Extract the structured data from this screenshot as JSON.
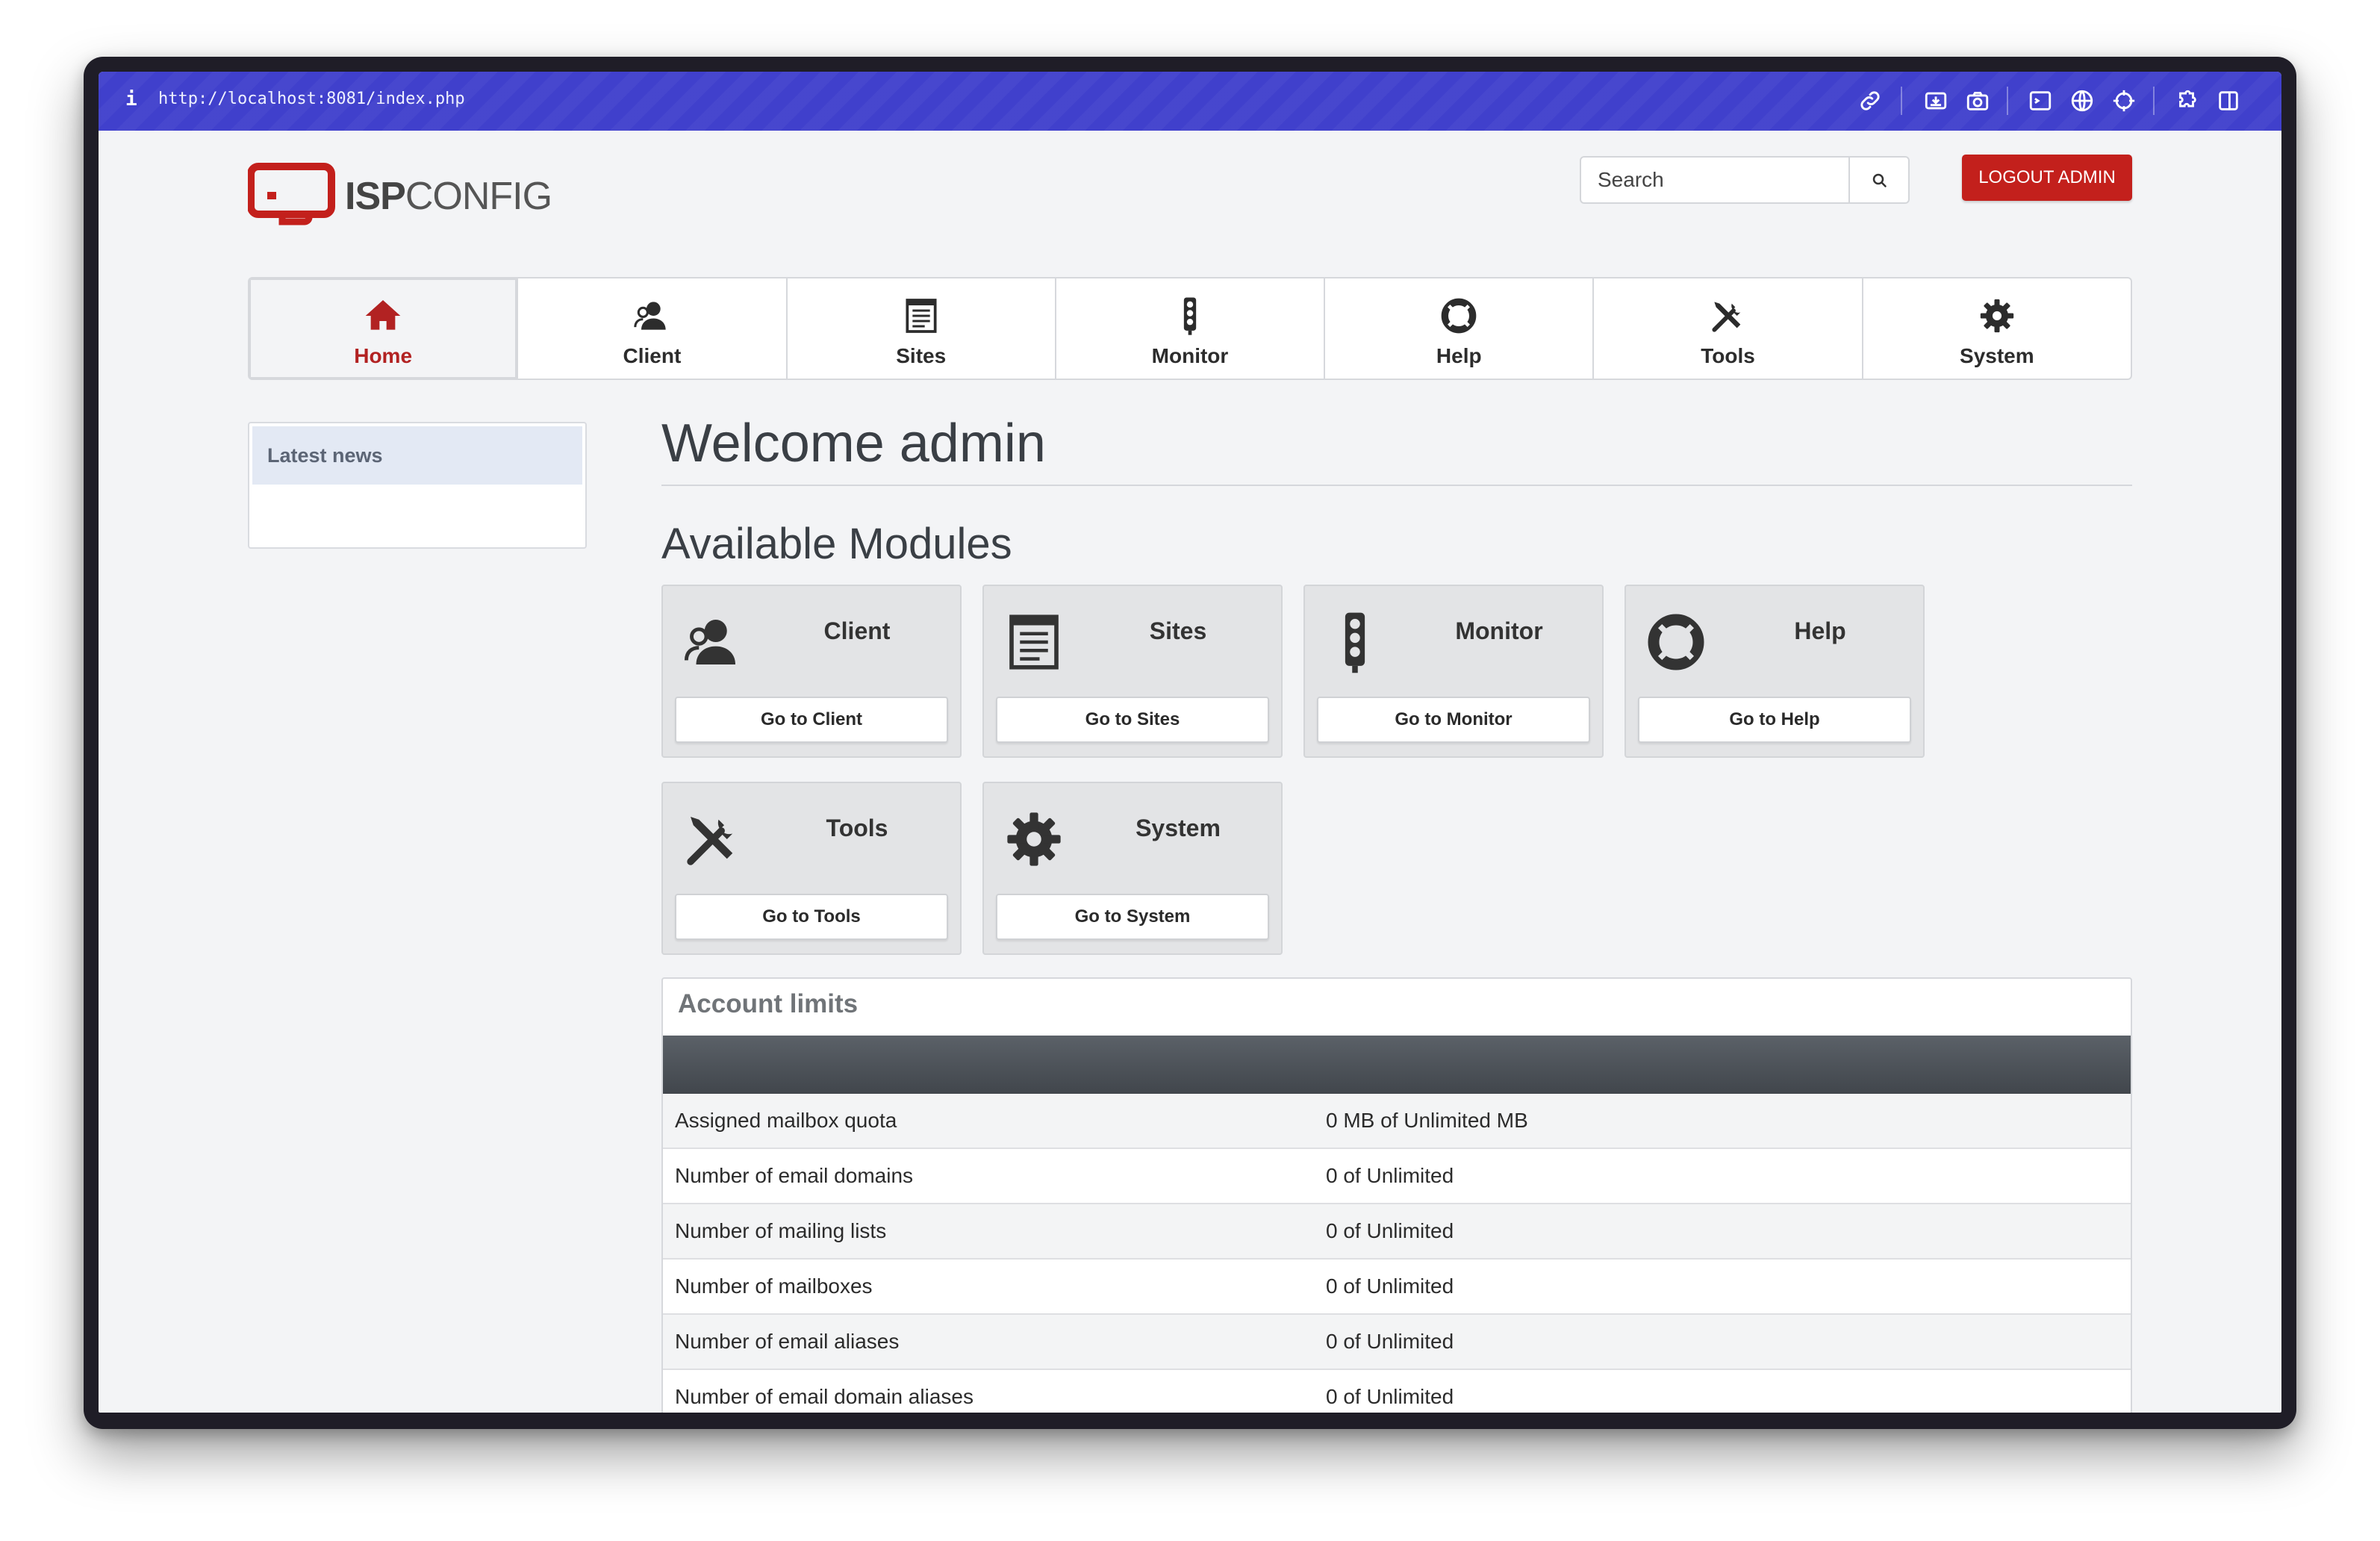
{
  "browser": {
    "info_glyph": "i",
    "url": "http://localhost:8081/index.php"
  },
  "brand": {
    "logo_bold": "ISP",
    "logo_light": "CONFIG",
    "accent_color": "#c3201c"
  },
  "header": {
    "search_placeholder": "Search",
    "logout_label": "LOGOUT ADMIN"
  },
  "nav": {
    "items": [
      {
        "label": "Home",
        "icon": "home-icon",
        "active": true
      },
      {
        "label": "Client",
        "icon": "client-icon"
      },
      {
        "label": "Sites",
        "icon": "sites-icon"
      },
      {
        "label": "Monitor",
        "icon": "monitor-icon"
      },
      {
        "label": "Help",
        "icon": "help-icon"
      },
      {
        "label": "Tools",
        "icon": "tools-icon"
      },
      {
        "label": "System",
        "icon": "system-icon"
      }
    ]
  },
  "sidebar": {
    "news_title": "Latest news"
  },
  "main": {
    "welcome": "Welcome admin",
    "modules_title": "Available Modules",
    "modules": [
      {
        "title": "Client",
        "button": "Go to Client",
        "icon": "client-icon"
      },
      {
        "title": "Sites",
        "button": "Go to Sites",
        "icon": "sites-icon"
      },
      {
        "title": "Monitor",
        "button": "Go to Monitor",
        "icon": "monitor-icon"
      },
      {
        "title": "Help",
        "button": "Go to Help",
        "icon": "help-icon"
      },
      {
        "title": "Tools",
        "button": "Go to Tools",
        "icon": "tools-icon"
      },
      {
        "title": "System",
        "button": "Go to System",
        "icon": "system-icon"
      }
    ]
  },
  "account_limits": {
    "title": "Account limits",
    "rows": [
      {
        "label": "Assigned mailbox quota",
        "value": "0 MB of Unlimited MB"
      },
      {
        "label": "Number of email domains",
        "value": "0 of Unlimited"
      },
      {
        "label": "Number of mailing lists",
        "value": "0 of Unlimited"
      },
      {
        "label": "Number of mailboxes",
        "value": "0 of Unlimited"
      },
      {
        "label": "Number of email aliases",
        "value": "0 of Unlimited"
      },
      {
        "label": "Number of email domain aliases",
        "value": "0 of Unlimited"
      }
    ]
  }
}
